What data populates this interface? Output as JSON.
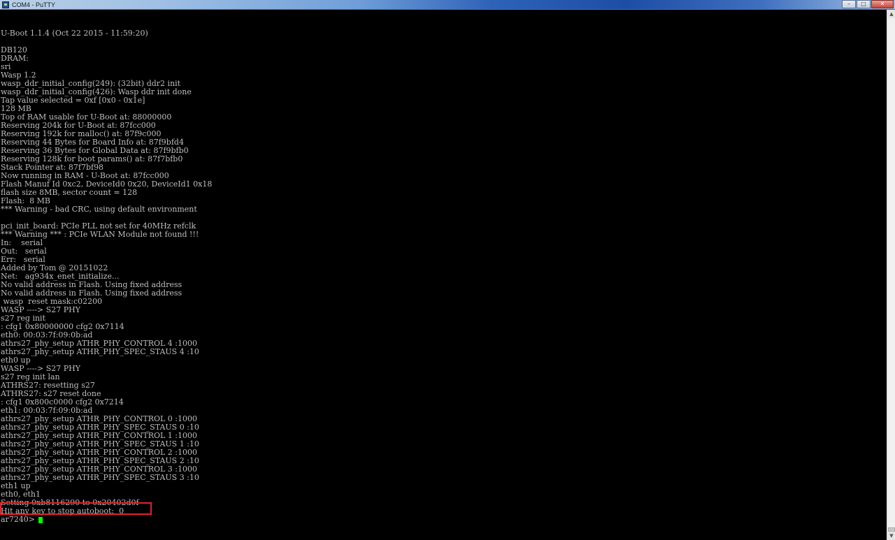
{
  "window": {
    "title": "COM4 - PuTTY",
    "minimize_glyph": "–",
    "maximize_glyph": "□",
    "close_glyph": "✕"
  },
  "terminal": {
    "lines": [
      "U-Boot 1.1.4 (Oct 22 2015 - 11:59:20)",
      "",
      "DB120",
      "DRAM:",
      "sri",
      "Wasp 1.2",
      "wasp_ddr_initial_config(249): (32bit) ddr2 init",
      "wasp_ddr_initial_config(426): Wasp ddr init done",
      "Tap value selected = 0xf [0x0 - 0x1e]",
      "128 MB",
      "Top of RAM usable for U-Boot at: 88000000",
      "Reserving 204k for U-Boot at: 87fcc000",
      "Reserving 192k for malloc() at: 87f9c000",
      "Reserving 44 Bytes for Board Info at: 87f9bfd4",
      "Reserving 36 Bytes for Global Data at: 87f9bfb0",
      "Reserving 128k for boot params() at: 87f7bfb0",
      "Stack Pointer at: 87f7bf98",
      "Now running in RAM - U-Boot at: 87fcc000",
      "Flash Manuf Id 0xc2, DeviceId0 0x20, DeviceId1 0x18",
      "flash size 8MB, sector count = 128",
      "Flash:  8 MB",
      "*** Warning - bad CRC, using default environment",
      "",
      "pci_init_board: PCIe PLL not set for 40MHz refclk",
      "*** Warning *** : PCIe WLAN Module not found !!!",
      "In:    serial",
      "Out:   serial",
      "Err:   serial",
      "Added by Tom @ 20151022",
      "Net:   ag934x_enet_initialize...",
      "No valid address in Flash. Using fixed address",
      "No valid address in Flash. Using fixed address",
      " wasp  reset mask:c02200",
      "WASP ----> S27 PHY",
      "s27 reg init",
      ": cfg1 0x80000000 cfg2 0x7114",
      "eth0: 00:03:7f:09:0b:ad",
      "athrs27_phy_setup ATHR_PHY_CONTROL 4 :1000",
      "athrs27_phy_setup ATHR_PHY_SPEC_STAUS 4 :10",
      "eth0 up",
      "WASP ----> S27 PHY",
      "s27 reg init lan",
      "ATHRS27: resetting s27",
      "ATHRS27: s27 reset done",
      ": cfg1 0x800c0000 cfg2 0x7214",
      "eth1: 00:03:7f:09:0b:ad",
      "athrs27_phy_setup ATHR_PHY_CONTROL 0 :1000",
      "athrs27_phy_setup ATHR_PHY_SPEC_STAUS 0 :10",
      "athrs27_phy_setup ATHR_PHY_CONTROL 1 :1000",
      "athrs27_phy_setup ATHR_PHY_SPEC_STAUS 1 :10",
      "athrs27_phy_setup ATHR_PHY_CONTROL 2 :1000",
      "athrs27_phy_setup ATHR_PHY_SPEC_STAUS 2 :10",
      "athrs27_phy_setup ATHR_PHY_CONTROL 3 :1000",
      "athrs27_phy_setup ATHR_PHY_SPEC_STAUS 3 :10",
      "eth1 up",
      "eth0, eth1",
      "Setting 0xb8116290 to 0x20402d0f",
      "Hit any key to stop autoboot:  0"
    ],
    "prompt": "ar7240> ",
    "cursor_color": "#00ff00",
    "text_color": "#bfbfbf",
    "background_color": "#000000",
    "highlight_color": "#e8202a"
  },
  "scrollbar": {
    "up_glyph": "▲",
    "down_glyph": "▼"
  }
}
